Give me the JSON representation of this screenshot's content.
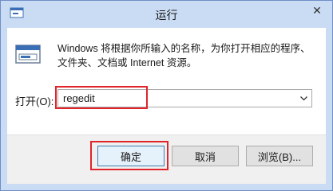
{
  "window": {
    "title": "运行",
    "close_glyph": "✕"
  },
  "description": {
    "line1": "Windows 将根据你所输入的名称，为你打开相应的程序、",
    "line2": "文件夹、文档或 Internet 资源。"
  },
  "open": {
    "label": "打开(O):",
    "value": "regedit"
  },
  "buttons": {
    "ok": "确定",
    "cancel": "取消",
    "browse": "浏览(B)..."
  },
  "icons": {
    "app": "run-app-icon",
    "dialog": "run-dialog-icon",
    "dropdown": "chevron-down-icon"
  },
  "colors": {
    "title_bar": "#c9dcf4",
    "highlight": "#e0242b",
    "footer": "#f0f0f0"
  }
}
